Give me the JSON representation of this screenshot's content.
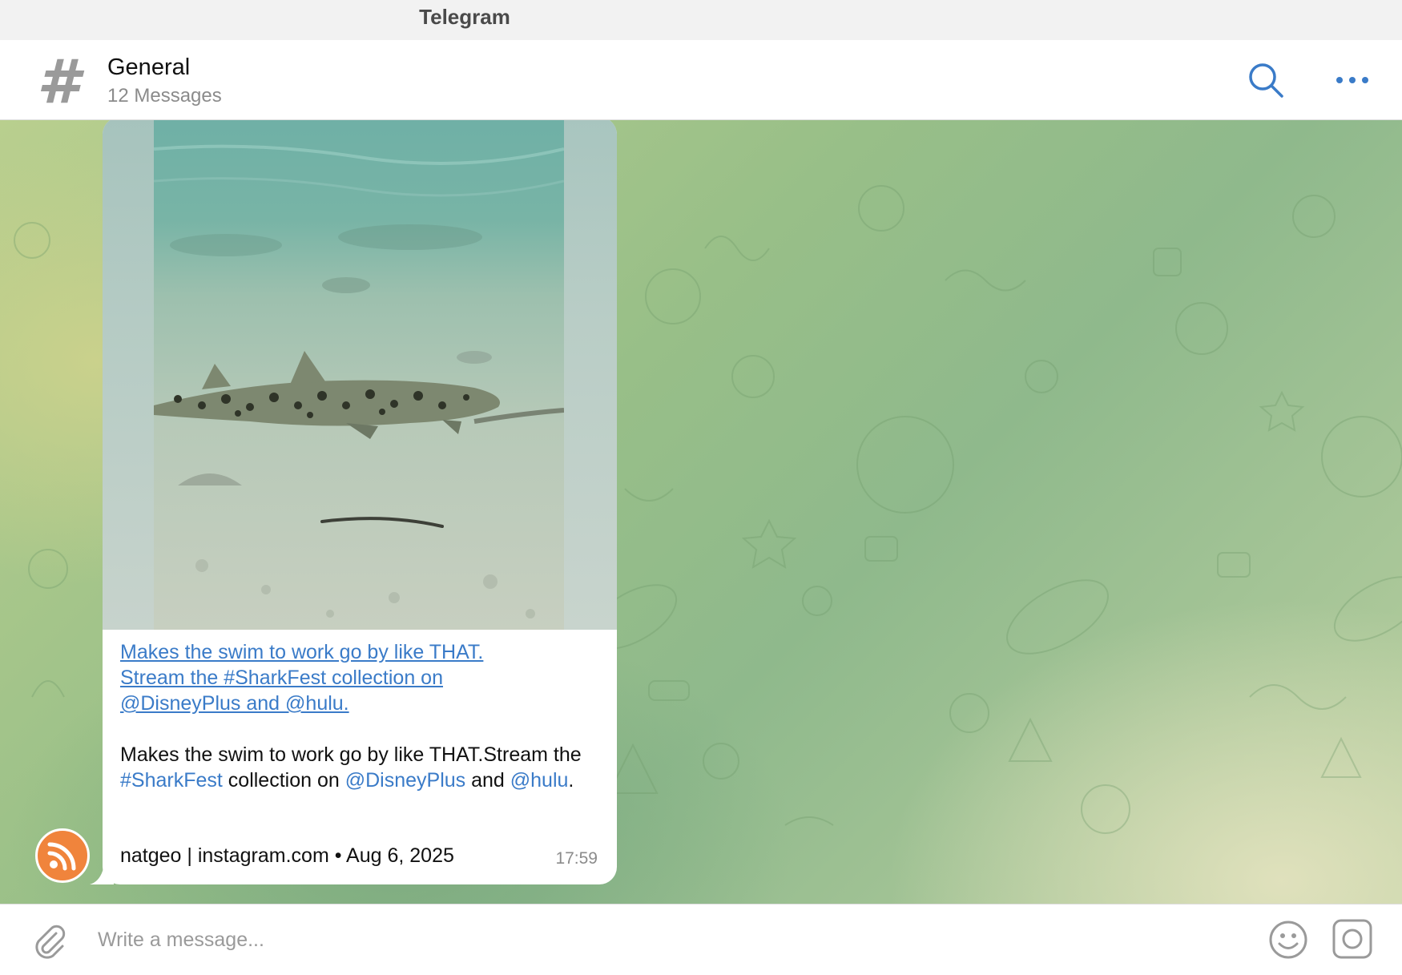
{
  "window": {
    "title": "Telegram"
  },
  "header": {
    "channel_title": "General",
    "subtitle": "12 Messages",
    "icons": [
      "hash-icon",
      "search-icon",
      "more-icon"
    ]
  },
  "message": {
    "link_title_lines": [
      "Makes the swim to work go by like THAT. ",
      "Stream the #SharkFest collection on ",
      "@DisneyPlus and @hulu."
    ],
    "desc": {
      "part1": "Makes the swim to work go by like THAT.Stream the ",
      "hashtag": "#SharkFest",
      "part2": " collection on ",
      "mention1": "@DisneyPlus",
      "part3": " and ",
      "mention2": "@hulu",
      "part4": "."
    },
    "source": "natgeo | instagram.com • Aug 6, 2025",
    "time": "17:59",
    "media_description": "shark-underwater-photo",
    "avatar_icon": "rss-icon"
  },
  "composer": {
    "placeholder": "Write a message...",
    "icons": [
      "paperclip-icon",
      "emoji-icon",
      "camera-icon"
    ]
  },
  "colors": {
    "accent": "#3a7bc8",
    "avatar": "#f0843c",
    "titlebar": "#f2f2f2"
  }
}
